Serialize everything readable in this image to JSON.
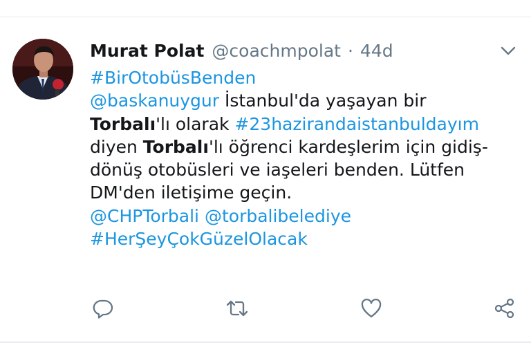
{
  "tweet": {
    "author": {
      "display_name": "Murat Polat",
      "handle": "@coachmpolat",
      "separator": "·",
      "time": "44d"
    },
    "lines": [
      [
        {
          "text": "#BirOtobüsBenden",
          "style": "link"
        }
      ],
      [
        {
          "text": "@baskanuygur",
          "style": "link"
        },
        {
          "text": " İstanbul'da yaşayan bir",
          "style": "plain"
        }
      ],
      [
        {
          "text": "Torbalı",
          "style": "bold"
        },
        {
          "text": "'lı olarak ",
          "style": "plain"
        },
        {
          "text": "#23hazirandaistanbuldayım",
          "style": "link"
        }
      ],
      [
        {
          "text": "diyen ",
          "style": "plain"
        },
        {
          "text": "Torbalı",
          "style": "bold"
        },
        {
          "text": "'lı öğrenci kardeşlerim için gidiş-",
          "style": "plain"
        }
      ],
      [
        {
          "text": "dönüş otobüsleri ve iaşeleri benden. Lütfen",
          "style": "plain"
        }
      ],
      [
        {
          "text": "DM'den iletişime geçin.",
          "style": "plain"
        }
      ],
      [
        {
          "text": "@CHPTorbali",
          "style": "link"
        },
        {
          "text": " ",
          "style": "plain"
        },
        {
          "text": "@torbalibelediye",
          "style": "link"
        }
      ],
      [
        {
          "text": "#HerŞeyÇokGüzelOlacak",
          "style": "link"
        }
      ]
    ]
  },
  "actions": [
    {
      "name": "reply",
      "icon": "reply-icon"
    },
    {
      "name": "retweet",
      "icon": "retweet-icon"
    },
    {
      "name": "like",
      "icon": "heart-icon"
    },
    {
      "name": "share",
      "icon": "share-icon"
    }
  ],
  "colors": {
    "link": "#1b95e0",
    "text": "#14171a",
    "muted": "#657786",
    "divider": "#e6ecf0"
  }
}
